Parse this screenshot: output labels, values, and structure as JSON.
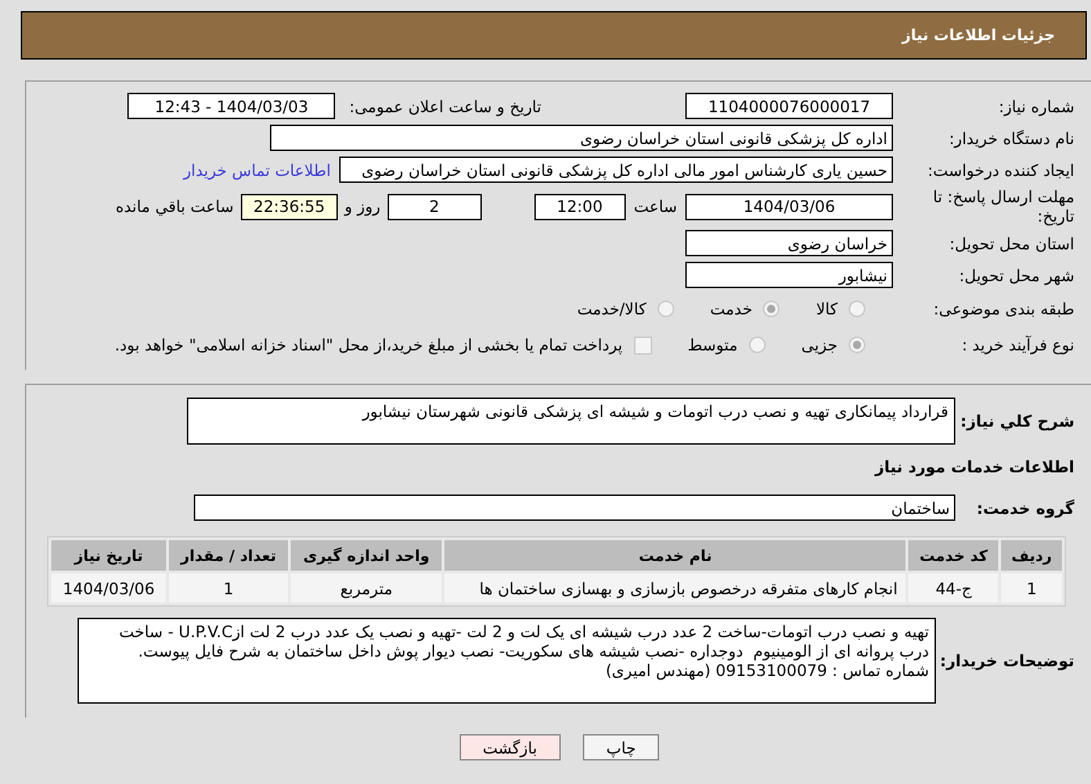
{
  "header": {
    "title": "جزئیات اطلاعات نیاز"
  },
  "need_number": {
    "label": "شماره نیاز:",
    "value": "1104000076000017"
  },
  "announce": {
    "label": "تاریخ و ساعت اعلان عمومی:",
    "value": "1404/03/03 - 12:43"
  },
  "buyer": {
    "label": "نام دستگاه خریدار:",
    "value": "اداره کل پزشکی قانونی استان خراسان رضوی"
  },
  "creator": {
    "label": "ایجاد کننده درخواست:",
    "value": "حسین یاری کارشناس امور مالی اداره کل پزشکی قانونی استان خراسان رضوی",
    "link": "اطلاعات تماس خریدار"
  },
  "deadline": {
    "label": "مهلت ارسال پاسخ: تا تاریخ:",
    "date": "1404/03/06",
    "time_label": "ساعت",
    "time": "12:00",
    "days": "2",
    "days_label": "روز و",
    "remaining": "22:36:55",
    "remaining_label": "ساعت باقي مانده"
  },
  "province": {
    "label": "استان محل تحویل:",
    "value": "خراسان رضوی"
  },
  "city": {
    "label": "شهر محل تحویل:",
    "value": "نیشابور"
  },
  "category": {
    "label": "طبقه بندی موضوعی:",
    "options": [
      {
        "label": "کالا",
        "selected": false
      },
      {
        "label": "خدمت",
        "selected": true
      },
      {
        "label": "کالا/خدمت",
        "selected": false
      }
    ]
  },
  "process": {
    "label": "نوع فرآیند خرید :",
    "options": [
      {
        "label": "جزیی",
        "selected": true
      },
      {
        "label": "متوسط",
        "selected": false
      }
    ],
    "treasury": {
      "checked": false,
      "text": "پرداخت تمام یا بخشی از مبلغ خرید،از محل \"اسناد خزانه اسلامی\" خواهد بود."
    }
  },
  "summary": {
    "label": "شرح كلي نياز:",
    "value": "قرارداد پیمانکاری تهیه و نصب درب اتومات و شیشه ای پزشکی قانونی شهرستان نیشابور"
  },
  "services_heading": "اطلاعات خدمات مورد نياز",
  "service_group": {
    "label": "گروه خدمت:",
    "value": "ساختمان"
  },
  "table": {
    "columns": [
      "ردیف",
      "کد خدمت",
      "نام خدمت",
      "واحد اندازه گیری",
      "تعداد / مقدار",
      "تاریخ نیاز"
    ],
    "rows": [
      [
        "1",
        "ج-44",
        "انجام کارهای متفرقه درخصوص بازسازی و بهسازی ساختمان ها",
        "مترمربع",
        "1",
        "1404/03/06"
      ]
    ]
  },
  "buyer_notes": {
    "label": "توضیحات خریدار:",
    "value": "تهیه و نصب درب اتومات-ساخت 2 عدد درب شیشه ای یک لت و 2 لت -تهیه و نصب یک عدد درب 2 لت ازU.P.V.C - ساخت درب پروانه ای از الومینیوم  دوجداره -نصب شیشه های سکوریت- نصب دیوار پوش داخل ساختمان به شرح فایل پیوست.\nشماره تماس : 09153100079 (مهندس امیری)"
  },
  "buttons": [
    {
      "label": "چاپ",
      "kind": "print"
    },
    {
      "label": "بازگشت",
      "kind": "back"
    }
  ]
}
